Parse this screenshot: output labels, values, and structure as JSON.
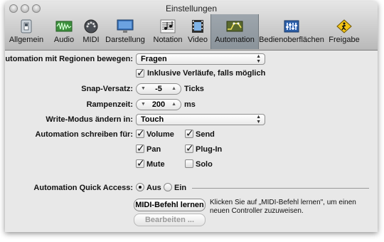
{
  "window": {
    "title": "Einstellungen"
  },
  "toolbar": {
    "items": [
      {
        "label": "Allgemein",
        "icon": "general-switch-icon"
      },
      {
        "label": "Audio",
        "icon": "audio-waveform-icon"
      },
      {
        "label": "MIDI",
        "icon": "midi-connector-icon"
      },
      {
        "label": "Darstellung",
        "icon": "display-monitor-icon"
      },
      {
        "label": "Notation",
        "icon": "notation-score-icon"
      },
      {
        "label": "Video",
        "icon": "video-film-icon"
      },
      {
        "label": "Automation",
        "icon": "automation-curve-icon",
        "selected": true
      },
      {
        "label": "Bedienoberflächen",
        "icon": "control-surface-icon"
      },
      {
        "label": "Freigabe",
        "icon": "sharing-sign-icon"
      }
    ]
  },
  "automation": {
    "move_with_regions": {
      "label": "Automation mit Regionen bewegen:",
      "value": "Fragen"
    },
    "include_curves": {
      "label": "Inklusive Verläufe, falls möglich",
      "checked": true
    },
    "snap_offset": {
      "label": "Snap-Versatz:",
      "value": "-5",
      "unit": "Ticks"
    },
    "ramp_time": {
      "label": "Rampenzeit:",
      "value": "200",
      "unit": "ms"
    },
    "write_mode": {
      "label": "Write-Modus ändern in:",
      "value": "Touch"
    },
    "write_for": {
      "label": "Automation schreiben für:",
      "options": [
        {
          "label": "Volume",
          "checked": true
        },
        {
          "label": "Send",
          "checked": true
        },
        {
          "label": "Pan",
          "checked": true
        },
        {
          "label": "Plug-In",
          "checked": true
        },
        {
          "label": "Mute",
          "checked": true
        },
        {
          "label": "Solo",
          "checked": false
        }
      ]
    }
  },
  "quick_access": {
    "label": "Automation Quick Access:",
    "off_label": "Aus",
    "on_label": "Ein",
    "selected": "Aus",
    "learn_button": "MIDI-Befehl lernen",
    "hint": "Klicken Sie auf „MIDI-Befehl lernen\", um einen neuen Controller zuzuweisen.",
    "edit_button": "Bearbeiten ..."
  },
  "colors": {
    "selected_tab": "#8f979e",
    "window_bg": "#e8e8e8"
  }
}
